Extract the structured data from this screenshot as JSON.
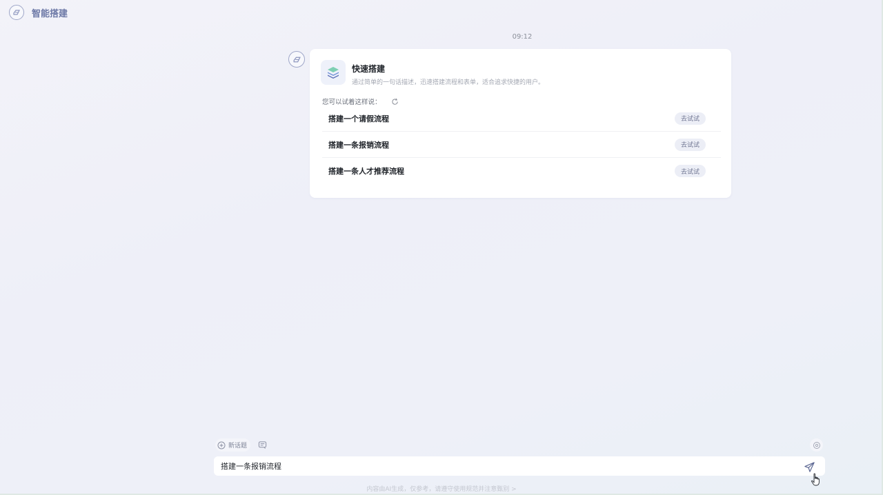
{
  "app": {
    "title": "智能搭建"
  },
  "chat": {
    "timestamp": "09:12",
    "card": {
      "title": "快速搭建",
      "description": "通过简单的一句话描述，迅速搭建流程和表单，适合追求快捷的用户。",
      "hint_label": "您可以试着这样说：",
      "suggestions": [
        {
          "text": "搭建一个请假流程",
          "action_label": "去试试"
        },
        {
          "text": "搭建一条报销流程",
          "action_label": "去试试"
        },
        {
          "text": "搭建一条人才推荐流程",
          "action_label": "去试试"
        }
      ]
    }
  },
  "toolbar": {
    "new_topic_label": "新话题"
  },
  "input": {
    "value": "搭建一条报销流程"
  },
  "footer": {
    "disclaimer": "内容由AI生成，仅参考，请遵守使用规范并注意甄别 >"
  },
  "colors": {
    "accent": "#6c78a6",
    "card_bg": "#ffffff",
    "try_button_bg": "#eceef6"
  }
}
